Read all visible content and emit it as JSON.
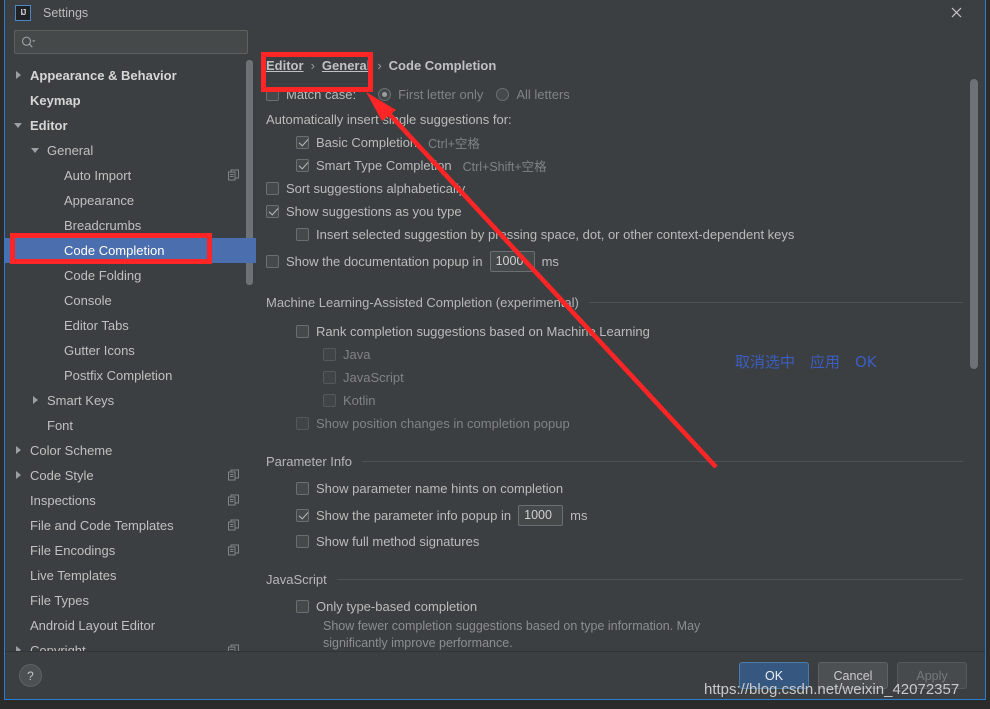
{
  "window": {
    "title": "Settings",
    "logo_text": "IJ",
    "close_icon": "close-icon"
  },
  "sidebar": {
    "search": {
      "value": "",
      "placeholder": ""
    },
    "items": [
      {
        "label": "Appearance & Behavior",
        "arrow": "right",
        "depth": 0,
        "bold": true,
        "selected": false,
        "copy": false
      },
      {
        "label": "Keymap",
        "arrow": "none",
        "depth": 0,
        "bold": true,
        "selected": false,
        "copy": false
      },
      {
        "label": "Editor",
        "arrow": "down",
        "depth": 0,
        "bold": true,
        "selected": false,
        "copy": false
      },
      {
        "label": "General",
        "arrow": "down",
        "depth": 1,
        "bold": false,
        "selected": false,
        "copy": false
      },
      {
        "label": "Auto Import",
        "arrow": "none",
        "depth": 2,
        "bold": false,
        "selected": false,
        "copy": true
      },
      {
        "label": "Appearance",
        "arrow": "none",
        "depth": 2,
        "bold": false,
        "selected": false,
        "copy": false
      },
      {
        "label": "Breadcrumbs",
        "arrow": "none",
        "depth": 2,
        "bold": false,
        "selected": false,
        "copy": false
      },
      {
        "label": "Code Completion",
        "arrow": "none",
        "depth": 2,
        "bold": false,
        "selected": true,
        "copy": false
      },
      {
        "label": "Code Folding",
        "arrow": "none",
        "depth": 2,
        "bold": false,
        "selected": false,
        "copy": false
      },
      {
        "label": "Console",
        "arrow": "none",
        "depth": 2,
        "bold": false,
        "selected": false,
        "copy": false
      },
      {
        "label": "Editor Tabs",
        "arrow": "none",
        "depth": 2,
        "bold": false,
        "selected": false,
        "copy": false
      },
      {
        "label": "Gutter Icons",
        "arrow": "none",
        "depth": 2,
        "bold": false,
        "selected": false,
        "copy": false
      },
      {
        "label": "Postfix Completion",
        "arrow": "none",
        "depth": 2,
        "bold": false,
        "selected": false,
        "copy": false
      },
      {
        "label": "Smart Keys",
        "arrow": "right",
        "depth": 1,
        "bold": false,
        "selected": false,
        "copy": false
      },
      {
        "label": "Font",
        "arrow": "none",
        "depth": 1,
        "bold": false,
        "selected": false,
        "copy": false
      },
      {
        "label": "Color Scheme",
        "arrow": "right",
        "depth": 0,
        "bold": false,
        "selected": false,
        "copy": false
      },
      {
        "label": "Code Style",
        "arrow": "right",
        "depth": 0,
        "bold": false,
        "selected": false,
        "copy": true
      },
      {
        "label": "Inspections",
        "arrow": "none",
        "depth": 0,
        "bold": false,
        "selected": false,
        "copy": true
      },
      {
        "label": "File and Code Templates",
        "arrow": "none",
        "depth": 0,
        "bold": false,
        "selected": false,
        "copy": true
      },
      {
        "label": "File Encodings",
        "arrow": "none",
        "depth": 0,
        "bold": false,
        "selected": false,
        "copy": true
      },
      {
        "label": "Live Templates",
        "arrow": "none",
        "depth": 0,
        "bold": false,
        "selected": false,
        "copy": false
      },
      {
        "label": "File Types",
        "arrow": "none",
        "depth": 0,
        "bold": false,
        "selected": false,
        "copy": false
      },
      {
        "label": "Android Layout Editor",
        "arrow": "none",
        "depth": 0,
        "bold": false,
        "selected": false,
        "copy": false
      },
      {
        "label": "Copyright",
        "arrow": "right",
        "depth": 0,
        "bold": false,
        "selected": false,
        "copy": true
      }
    ]
  },
  "breadcrumb": {
    "items": [
      "Editor",
      "General",
      "Code Completion"
    ],
    "separator": "›"
  },
  "settings": {
    "match_case": {
      "label": "Match case:",
      "checked": false,
      "options": [
        {
          "label": "First letter only",
          "selected": true
        },
        {
          "label": "All letters",
          "selected": false
        }
      ]
    },
    "auto_insert_header": "Automatically insert single suggestions for:",
    "auto_insert": [
      {
        "label": "Basic Completion",
        "shortcut": "Ctrl+空格",
        "checked": true
      },
      {
        "label": "Smart Type Completion",
        "shortcut": "Ctrl+Shift+空格",
        "checked": true
      }
    ],
    "sort_alphabetically": {
      "label": "Sort suggestions alphabetically",
      "checked": false
    },
    "show_as_you_type": {
      "label": "Show suggestions as you type",
      "checked": true
    },
    "insert_selected": {
      "label": "Insert selected suggestion by pressing space, dot, or other context-dependent keys",
      "checked": false
    },
    "doc_popup": {
      "label": "Show the documentation popup in",
      "value": "1000",
      "unit": "ms",
      "checked": false
    },
    "ml_section": {
      "title": "Machine Learning-Assisted Completion (experimental)",
      "rank": {
        "label": "Rank completion suggestions based on Machine Learning",
        "checked": false
      },
      "languages": [
        {
          "label": "Java",
          "checked": false
        },
        {
          "label": "JavaScript",
          "checked": false
        },
        {
          "label": "Kotlin",
          "checked": false
        }
      ],
      "position_changes": {
        "label": "Show position changes in completion popup",
        "checked": false
      }
    },
    "param_section": {
      "title": "Parameter Info",
      "name_hints": {
        "label": "Show parameter name hints on completion",
        "checked": false
      },
      "info_popup": {
        "label": "Show the parameter info popup in",
        "value": "1000",
        "unit": "ms",
        "checked": true
      },
      "full_signatures": {
        "label": "Show full method signatures",
        "checked": false
      }
    },
    "js_section": {
      "title": "JavaScript",
      "only_type_based": {
        "label": "Only type-based completion",
        "checked": false
      },
      "description_line1": "Show fewer completion suggestions based on type information. May",
      "description_line2": "significantly improve performance."
    }
  },
  "footer": {
    "help_label": "?",
    "ok_label": "OK",
    "cancel_label": "Cancel",
    "apply_label": "Apply"
  },
  "annotations": {
    "chinese_note": "取消选中　应用　OK",
    "watermark": "https://blog.csdn.net/weixin_42072357",
    "highlight_color": "#fd2525"
  }
}
